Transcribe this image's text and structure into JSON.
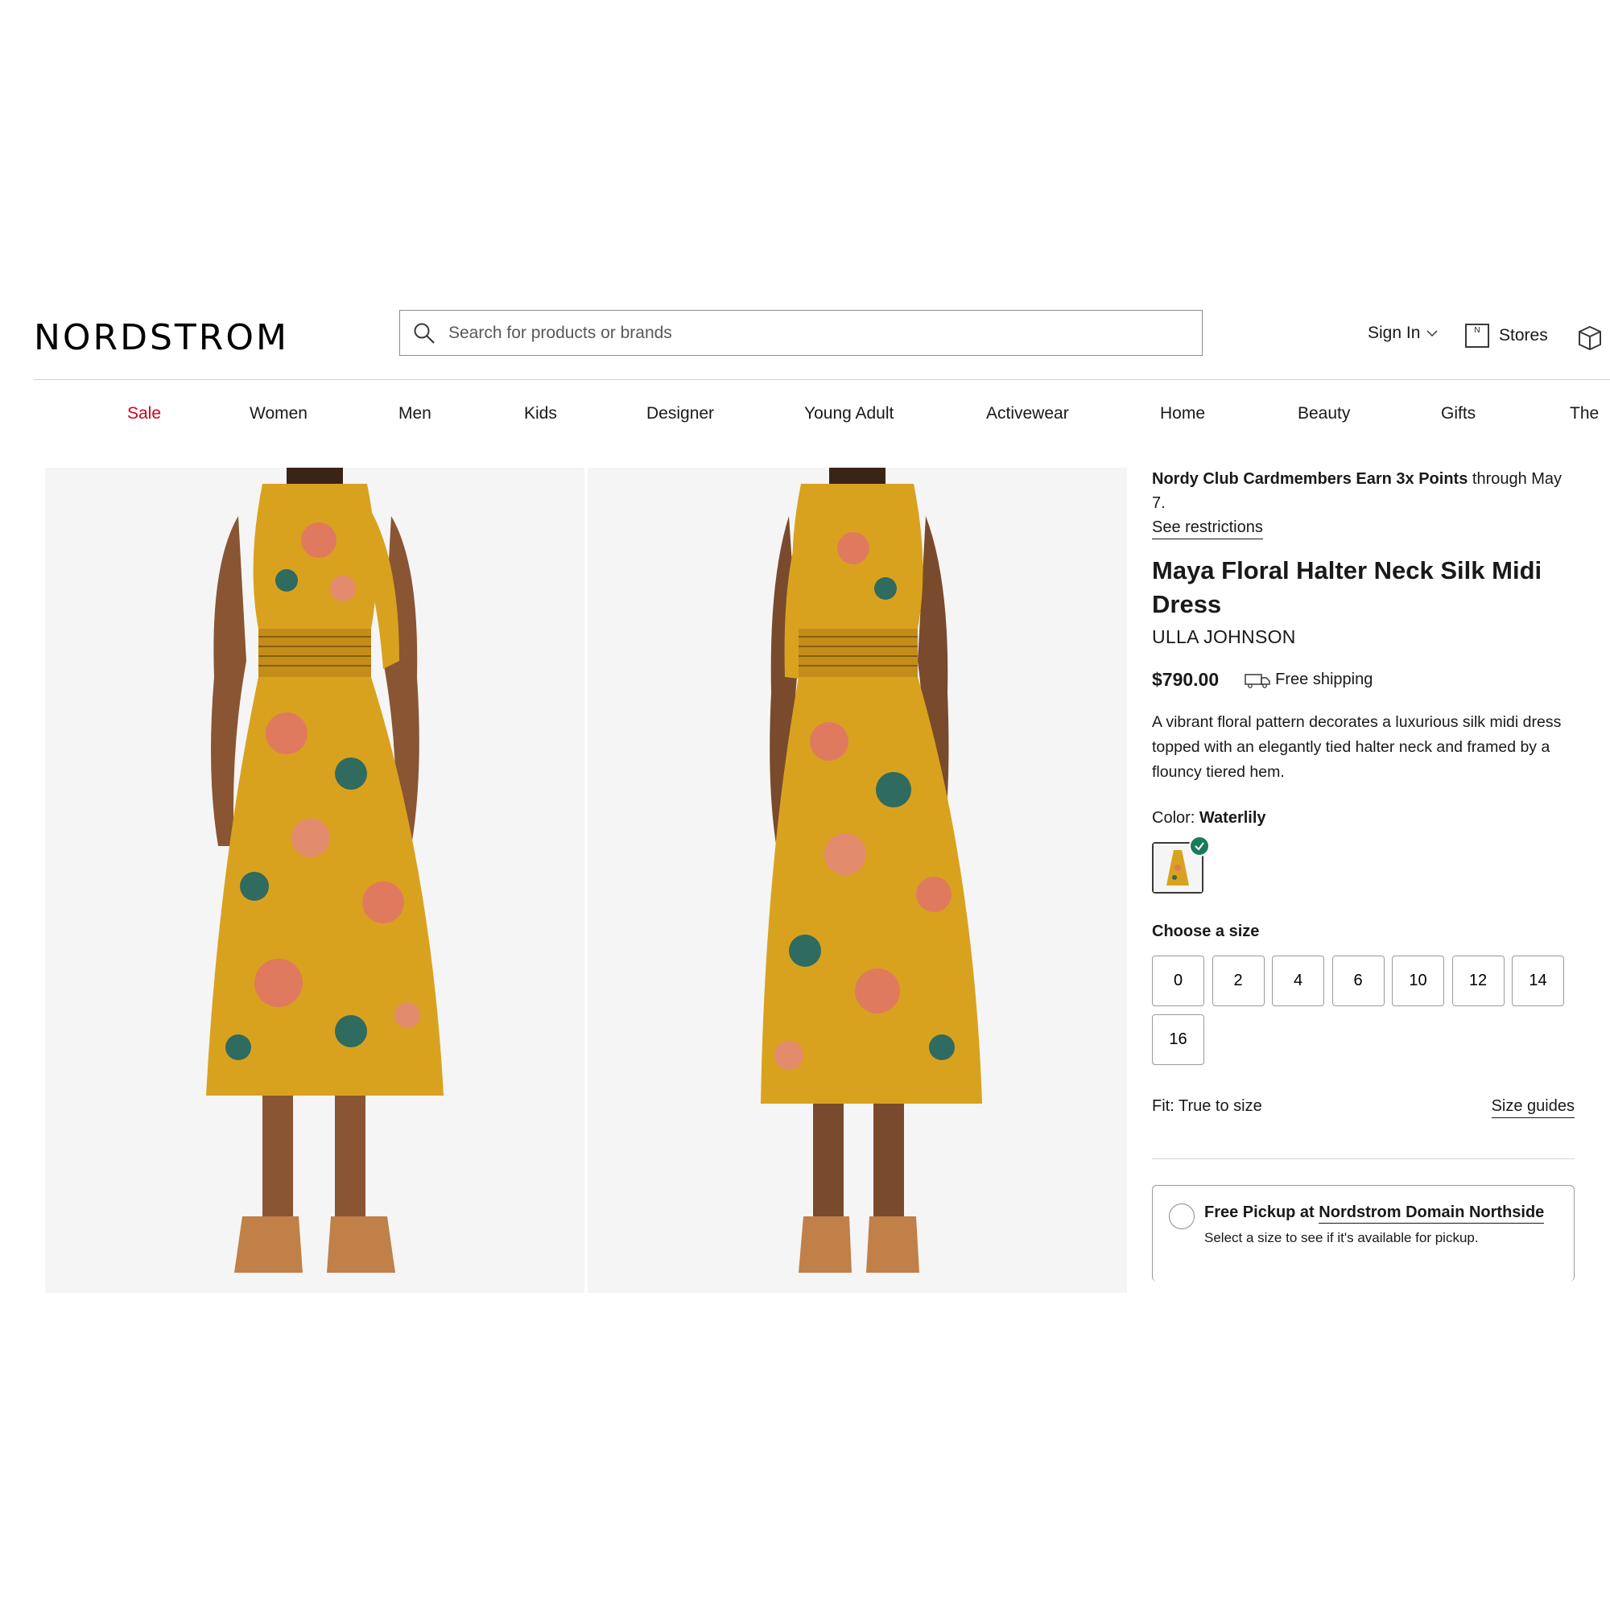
{
  "header": {
    "logo": "NORDSTROM",
    "search_placeholder": "Search for products or brands",
    "sign_in": "Sign In",
    "stores": "Stores"
  },
  "nav": {
    "items": [
      "Sale",
      "Women",
      "Men",
      "Kids",
      "Designer",
      "Young Adult",
      "Activewear",
      "Home",
      "Beauty",
      "Gifts",
      "The"
    ]
  },
  "product": {
    "promo_bold": "Nordy Club Cardmembers Earn 3x Points",
    "promo_rest": " through May 7.",
    "promo_link": "See restrictions",
    "title": "Maya Floral Halter Neck Silk Midi Dress",
    "brand": "ULLA JOHNSON",
    "price": "$790.00",
    "shipping": "Free shipping",
    "description": "A vibrant floral pattern decorates a luxurious silk midi dress topped with an elegantly tied halter neck and framed by a flouncy tiered hem.",
    "color_label": "Color: ",
    "color_value": "Waterlily",
    "size_label": "Choose a size",
    "sizes": [
      "0",
      "2",
      "4",
      "6",
      "10",
      "12",
      "14",
      "16"
    ],
    "fit": "Fit: True to size",
    "size_guides": "Size guides",
    "pickup_prefix": "Free Pickup at ",
    "pickup_store": "Nordstrom Domain Northside",
    "pickup_note": "Select a size to see if it's available for pickup."
  },
  "colors": {
    "sale_red": "#d6001c",
    "dress_yellow": "#d9a21e",
    "check_green": "#1b7a5c"
  }
}
